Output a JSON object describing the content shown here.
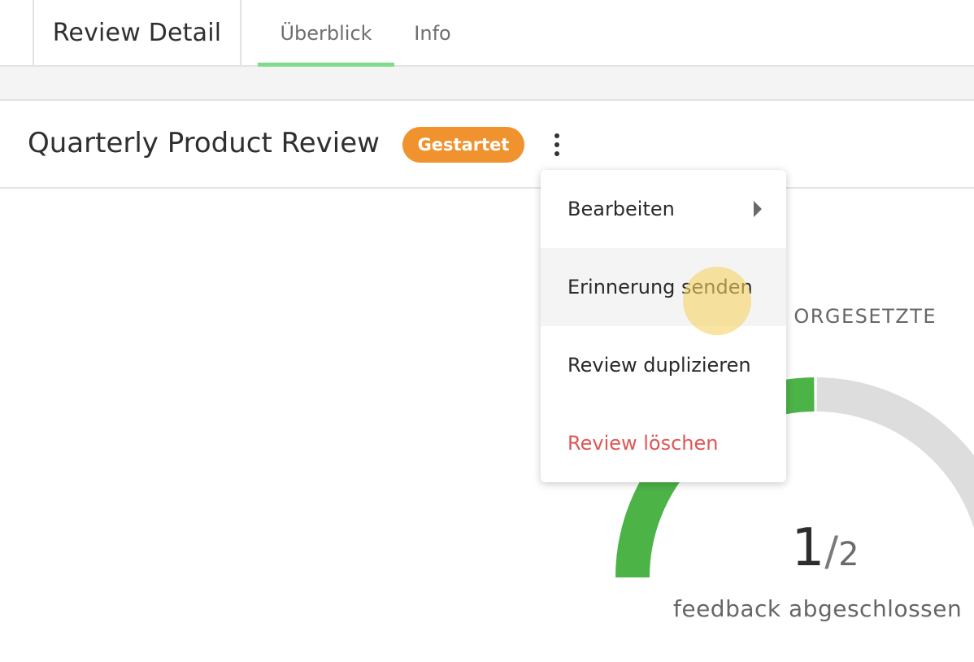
{
  "header": {
    "title": "Review Detail",
    "tabs": [
      {
        "label": "Überblick",
        "active": true
      },
      {
        "label": "Info",
        "active": false
      }
    ]
  },
  "review": {
    "title": "Quarterly Product Review",
    "status": "Gestartet",
    "status_color": "#f0922e",
    "more_icon": "more-vertical-icon"
  },
  "context_menu": {
    "items": [
      {
        "label": "Bearbeiten",
        "has_submenu": true
      },
      {
        "label": "Erinnerung senden",
        "hovered": true
      },
      {
        "label": "Review duplizieren"
      },
      {
        "label": "Review löschen",
        "danger": true,
        "color": "#e05555"
      }
    ]
  },
  "progress": {
    "section_label": "ORGESETZTE",
    "completed": "1",
    "separator": "/",
    "total": "2",
    "completed_fraction": 0.5,
    "caption": "feedback abgeschlossen",
    "complete_color": "#4cb347",
    "remaining_color": "#dddddd"
  },
  "accent": {
    "tab_underline": "#7fdc8c"
  }
}
